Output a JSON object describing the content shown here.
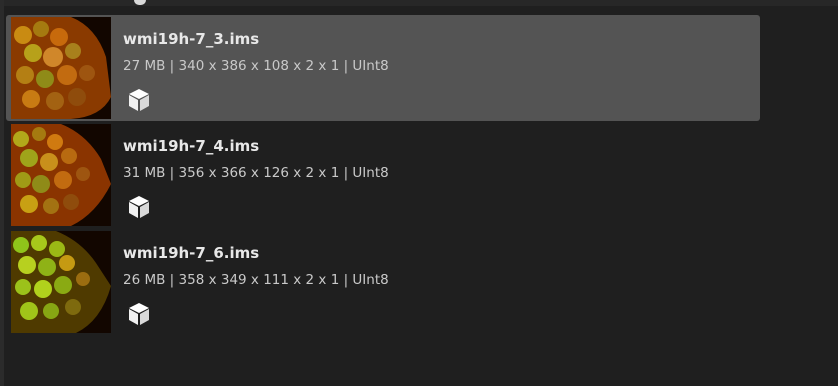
{
  "files": [
    {
      "name": "wmi19h-7_3.ims",
      "details": "27 MB | 340 x 386 x 108 x 2 x 1 | UInt8",
      "icon": "cube-icon",
      "selected": true
    },
    {
      "name": "wmi19h-7_4.ims",
      "details": "31 MB | 356 x 366 x 126 x 2 x 1 | UInt8",
      "icon": "cube-icon",
      "selected": false
    },
    {
      "name": "wmi19h-7_6.ims",
      "details": "26 MB | 358 x 349 x 111 x 2 x 1 | UInt8",
      "icon": "cube-icon",
      "selected": false
    }
  ],
  "colors": {
    "background": "#1f1f1f",
    "selected_row": "#545454",
    "title_text": "#e8e8e8",
    "meta_text": "#c9c9c9"
  }
}
